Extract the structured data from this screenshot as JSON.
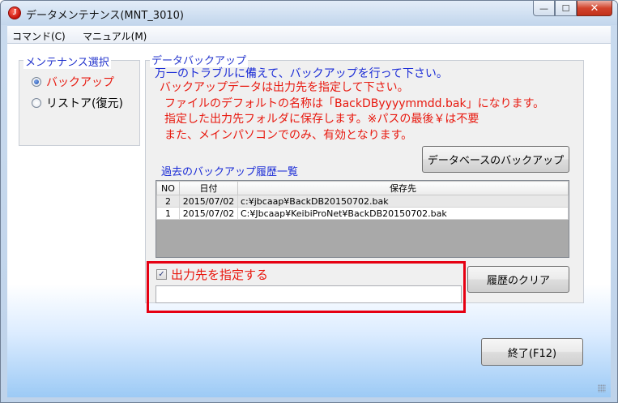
{
  "window": {
    "title": "データメンテナンス(MNT_3010)",
    "icon_letter": "J",
    "minimize_glyph": "—",
    "maximize_glyph": "☐",
    "close_glyph": "✕"
  },
  "menu": {
    "items": [
      {
        "label": "コマンド(C)"
      },
      {
        "label": "マニュアル(M)"
      }
    ]
  },
  "maintenance_group": {
    "title": "メンテナンス選択",
    "options": [
      {
        "label": "バックアップ",
        "selected": true
      },
      {
        "label": "リストア(復元)",
        "selected": false
      }
    ]
  },
  "backup_group": {
    "title": "データバックアップ",
    "message_lines": [
      "万一のトラブルに備えて、バックアップを行って下さい。",
      "バックアップデータは出力先を指定して下さい。",
      "ファイルのデフォルトの名称は「BackDByyyymmdd.bak」になります。",
      "指定した出力先フォルダに保存します。※パスの最後￥は不要",
      "また、メインパソコンでのみ、有効となります。"
    ],
    "backup_button": "データベースのバックアップ",
    "history_title": "過去のバックアップ履歴一覧",
    "history_table": {
      "columns": [
        "NO",
        "日付",
        "保存先"
      ],
      "rows": [
        [
          "2",
          "2015/07/02",
          "c:¥jbcaap¥BackDB20150702.bak"
        ],
        [
          "1",
          "2015/07/02",
          "C:¥Jbcaap¥KeibiProNet¥BackDB20150702.bak"
        ]
      ]
    },
    "specify_output": {
      "label": "出力先を指定する",
      "checked": true
    },
    "output_path": {
      "value": ""
    },
    "clear_button": "履歴のクリア"
  },
  "exit_button": "終了(F12)",
  "colors": {
    "highlight_border": "#e60012",
    "blue_text": "#1a2bd6",
    "red_text": "#e8180e"
  }
}
